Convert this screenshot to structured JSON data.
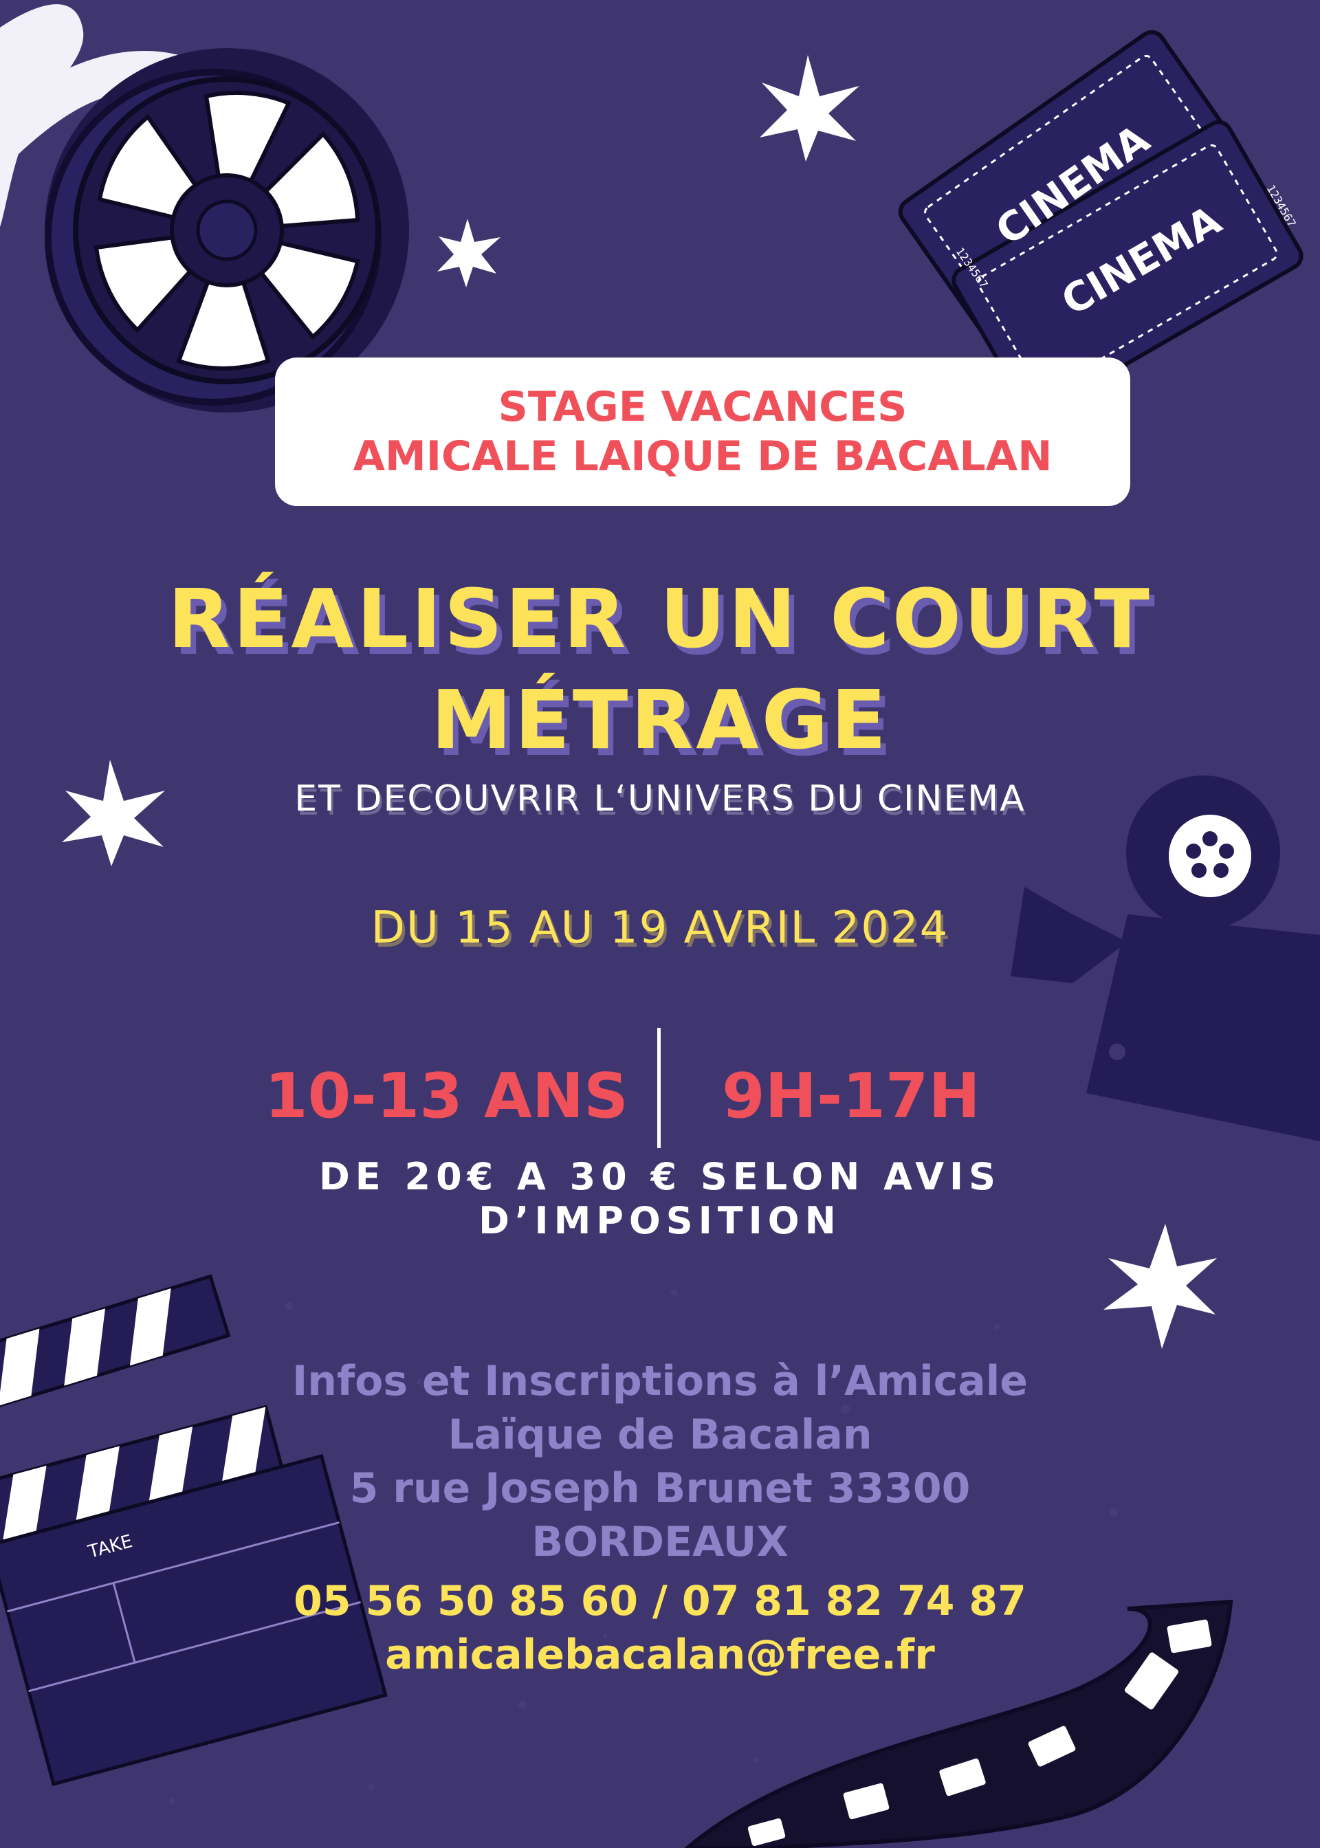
{
  "header": {
    "line1": "STAGE VACANCES",
    "line2": "AMICALE LAIQUE DE BACALAN"
  },
  "title": {
    "line1": "RÉALISER UN COURT",
    "line2": "MÉTRAGE"
  },
  "subtitle": "ET DECOUVRIR L‘UNIVERS DU CINEMA",
  "dates": "DU 15 AU 19 AVRIL 2024",
  "ages": "10-13 ANS",
  "hours": "9H-17H",
  "price": {
    "line1": "DE 20€ A 30 € SELON AVIS",
    "line2": "D’IMPOSITION"
  },
  "info": {
    "line1": "Infos et Inscriptions à l’Amicale",
    "line2": "Laïque de Bacalan",
    "line3": "5 rue Joseph Brunet 33300",
    "line4": "BORDEAUX"
  },
  "contact": {
    "phones": "05 56 50 85 60 / 07 81 82 74 87",
    "email": "amicalebacalan@free.fr"
  },
  "tickets": {
    "label": "CINEMA",
    "number": "1234567"
  },
  "clapper_label": "TAKE",
  "colors": {
    "background": "#3f3670",
    "dark_purple": "#241c54",
    "yellow": "#fde35a",
    "red": "#f0505a",
    "lavender": "#8f82c8",
    "white": "#ffffff"
  },
  "icons": [
    "film-reel-icon",
    "cinema-tickets-icon",
    "movie-camera-icon",
    "clapperboard-icon",
    "film-strip-icon",
    "sparkle-star-icon"
  ]
}
